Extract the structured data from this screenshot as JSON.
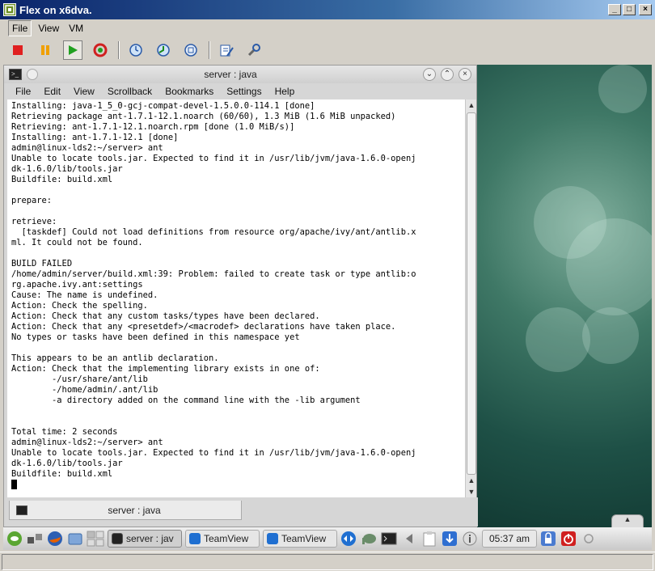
{
  "window": {
    "title": "Flex on x6dva."
  },
  "menubar": {
    "items": [
      "File",
      "View",
      "VM"
    ]
  },
  "toolbar": {
    "buttons": [
      "power-off",
      "suspend",
      "power-on",
      "reset",
      "snapshot",
      "revert-snapshot",
      "snapshot-manager",
      "edit-settings",
      "preferences"
    ]
  },
  "terminal": {
    "title": "server : java",
    "menu": [
      "File",
      "Edit",
      "View",
      "Scrollback",
      "Bookmarks",
      "Settings",
      "Help"
    ],
    "lines": [
      "Installing: java-1_5_0-gcj-compat-devel-1.5.0.0-114.1 [done]",
      "Retrieving package ant-1.7.1-12.1.noarch (60/60), 1.3 MiB (1.6 MiB unpacked)",
      "Retrieving: ant-1.7.1-12.1.noarch.rpm [done (1.0 MiB/s)]",
      "Installing: ant-1.7.1-12.1 [done]",
      "admin@linux-lds2:~/server> ant",
      "Unable to locate tools.jar. Expected to find it in /usr/lib/jvm/java-1.6.0-openj",
      "dk-1.6.0/lib/tools.jar",
      "Buildfile: build.xml",
      "",
      "prepare:",
      "",
      "retrieve:",
      "  [taskdef] Could not load definitions from resource org/apache/ivy/ant/antlib.x",
      "ml. It could not be found.",
      "",
      "BUILD FAILED",
      "/home/admin/server/build.xml:39: Problem: failed to create task or type antlib:o",
      "rg.apache.ivy.ant:settings",
      "Cause: The name is undefined.",
      "Action: Check the spelling.",
      "Action: Check that any custom tasks/types have been declared.",
      "Action: Check that any <presetdef>/<macrodef> declarations have taken place.",
      "No types or tasks have been defined in this namespace yet",
      "",
      "This appears to be an antlib declaration.",
      "Action: Check that the implementing library exists in one of:",
      "        -/usr/share/ant/lib",
      "        -/home/admin/.ant/lib",
      "        -a directory added on the command line with the -lib argument",
      "",
      "",
      "Total time: 2 seconds",
      "admin@linux-lds2:~/server> ant",
      "Unable to locate tools.jar. Expected to find it in /usr/lib/jvm/java-1.6.0-openj",
      "dk-1.6.0/lib/tools.jar",
      "Buildfile: build.xml"
    ],
    "tab_label": "server : java"
  },
  "taskbar": {
    "tasks": [
      {
        "label": "server : jav",
        "icon": "terminal-icon",
        "active": true
      },
      {
        "label": "TeamView",
        "icon": "teamviewer-icon",
        "active": false
      },
      {
        "label": "TeamView",
        "icon": "teamviewer-icon",
        "active": false
      }
    ],
    "clock": "05:37 am"
  },
  "colors": {
    "title_gradient_start": "#0a246a",
    "desktop_green": "#1e5046",
    "teamviewer_blue": "#1f6fd1"
  }
}
